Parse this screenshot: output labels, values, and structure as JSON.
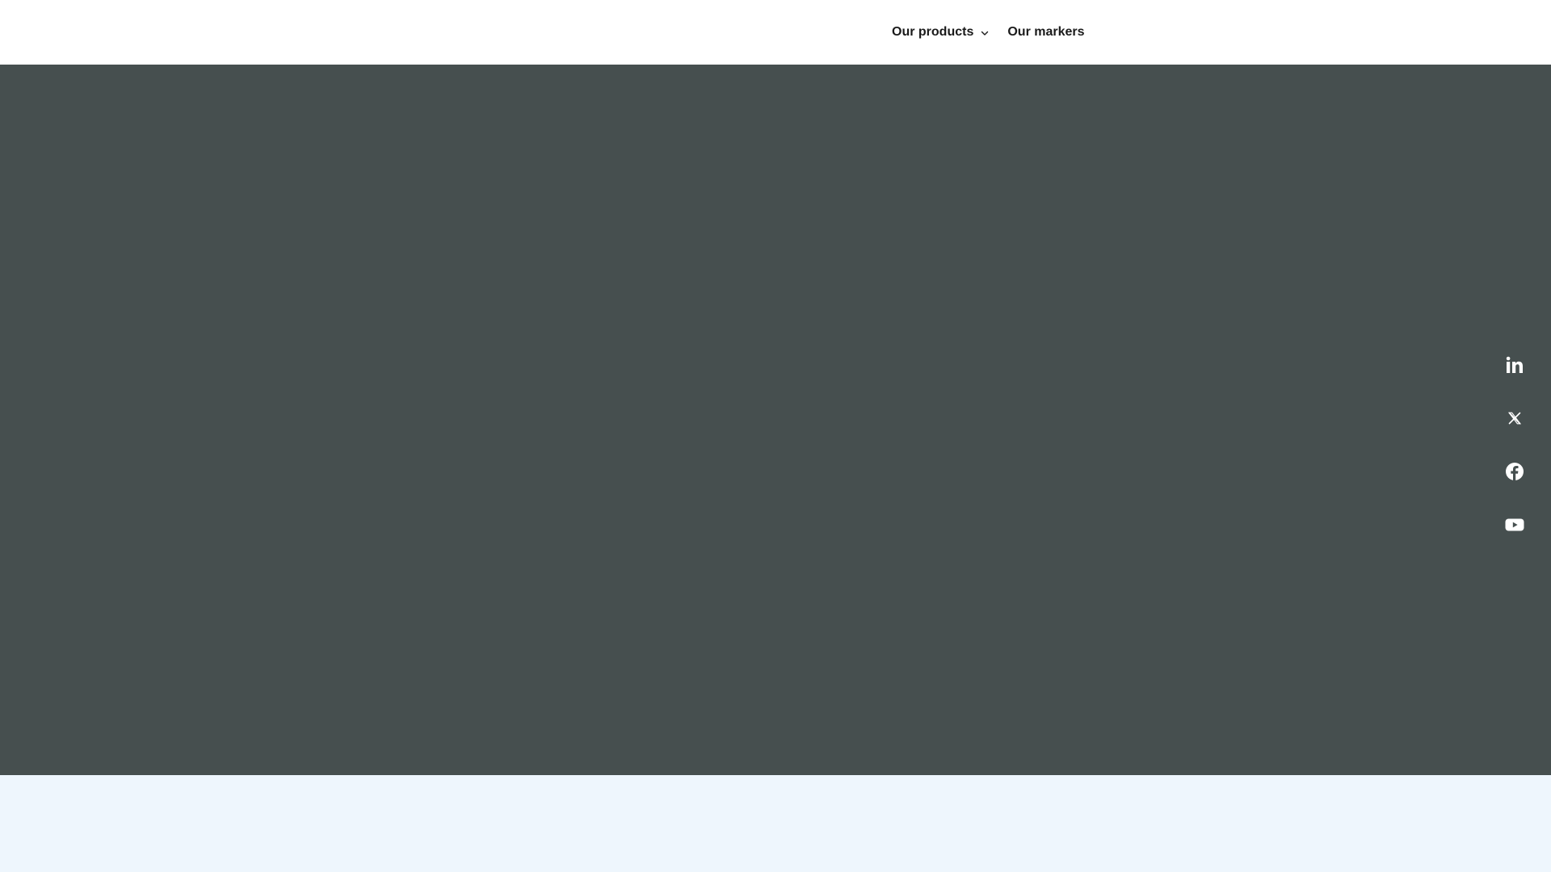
{
  "header": {
    "nav": {
      "products_label": "Our products",
      "markers_label": "Our markers"
    }
  },
  "social": {
    "items": [
      {
        "icon": "linkedin-icon"
      },
      {
        "icon": "x-twitter-icon"
      },
      {
        "icon": "facebook-icon"
      },
      {
        "icon": "youtube-icon"
      }
    ]
  },
  "colors": {
    "header_bg": "#ffffff",
    "hero_bg": "#464f4f",
    "lower_bg": "#eef6fd",
    "nav_text": "#1a1a1a",
    "icon": "#ffffff"
  }
}
